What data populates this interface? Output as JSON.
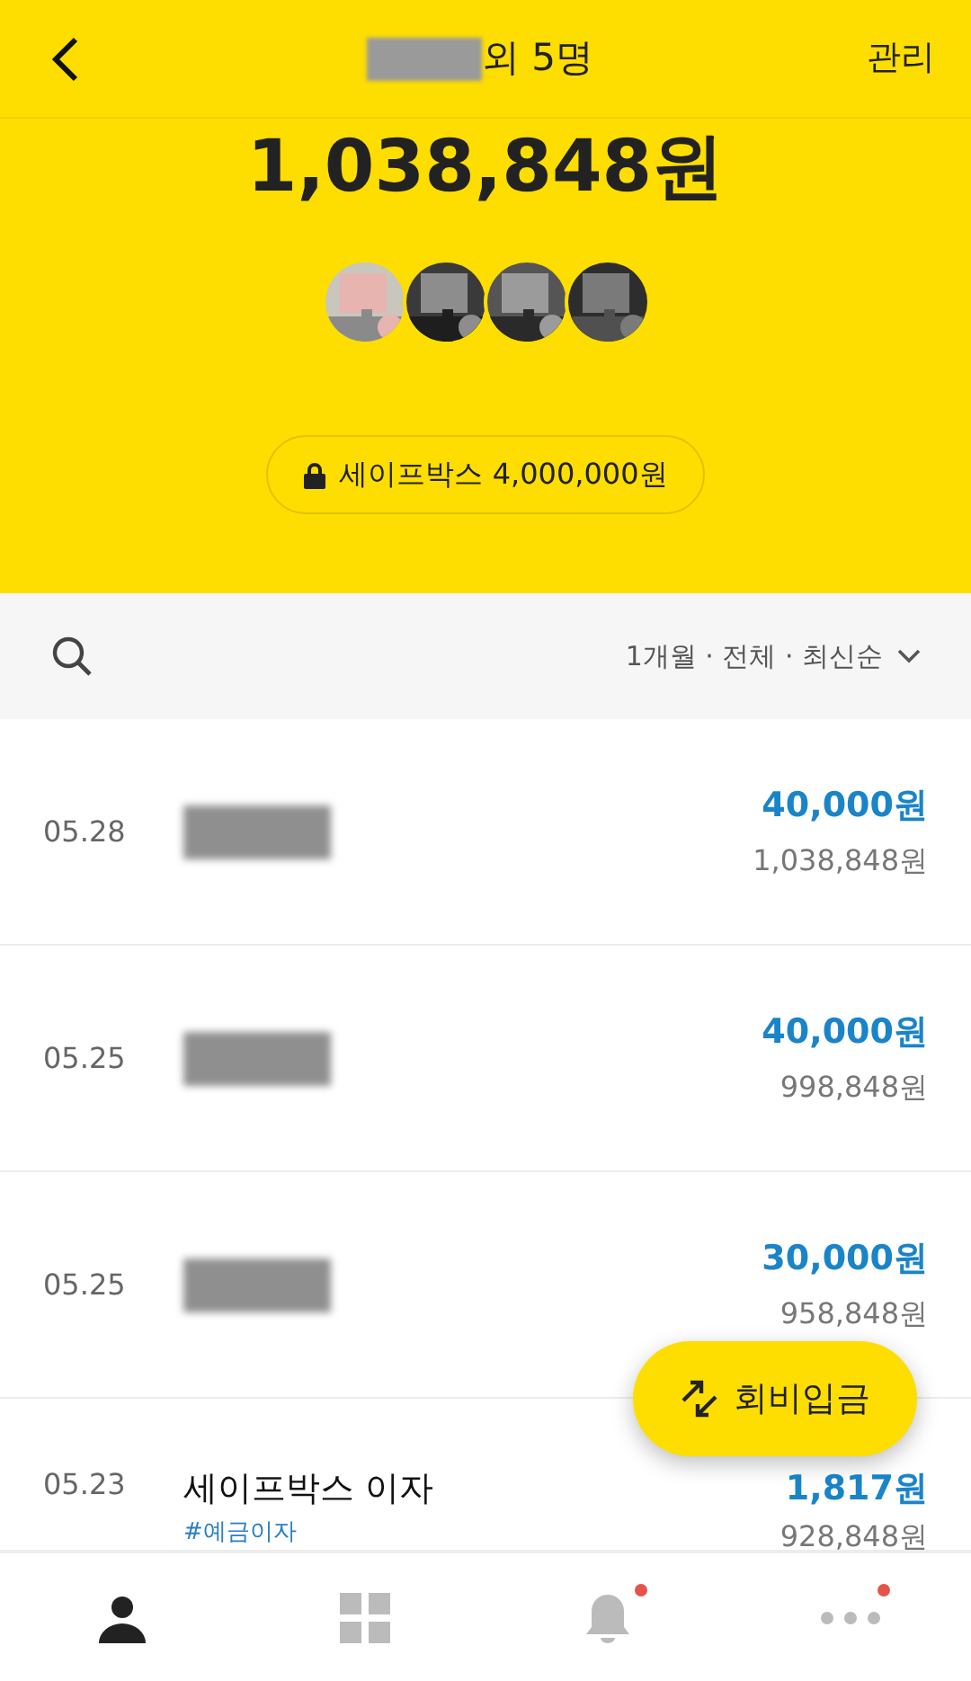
{
  "header": {
    "title_suffix": "외 5명",
    "title_redacted": true,
    "manage": "관리"
  },
  "balance": "1,038,848원",
  "safebox": {
    "label": "세이프박스 4,000,000원"
  },
  "filter": {
    "label": "1개월 · 전체 · 최신순"
  },
  "transactions": [
    {
      "date": "05.28",
      "name_redacted": true,
      "amount": "40,000원",
      "balance": "1,038,848원"
    },
    {
      "date": "05.25",
      "name_redacted": true,
      "amount": "40,000원",
      "balance": "998,848원"
    },
    {
      "date": "05.25",
      "name_redacted": true,
      "amount": "30,000원",
      "balance": "958,848원"
    },
    {
      "date": "05.23",
      "name": "세이프박스 이자",
      "tag": "#예금이자",
      "amount": "1,817원",
      "balance": "928,848원"
    }
  ],
  "fab": {
    "label": "회비입금"
  },
  "nav": [
    {
      "kind": "person",
      "selected": true,
      "badge": false
    },
    {
      "kind": "grid",
      "selected": false,
      "badge": false
    },
    {
      "kind": "bell",
      "selected": false,
      "badge": true
    },
    {
      "kind": "more",
      "selected": false,
      "badge": true
    }
  ]
}
